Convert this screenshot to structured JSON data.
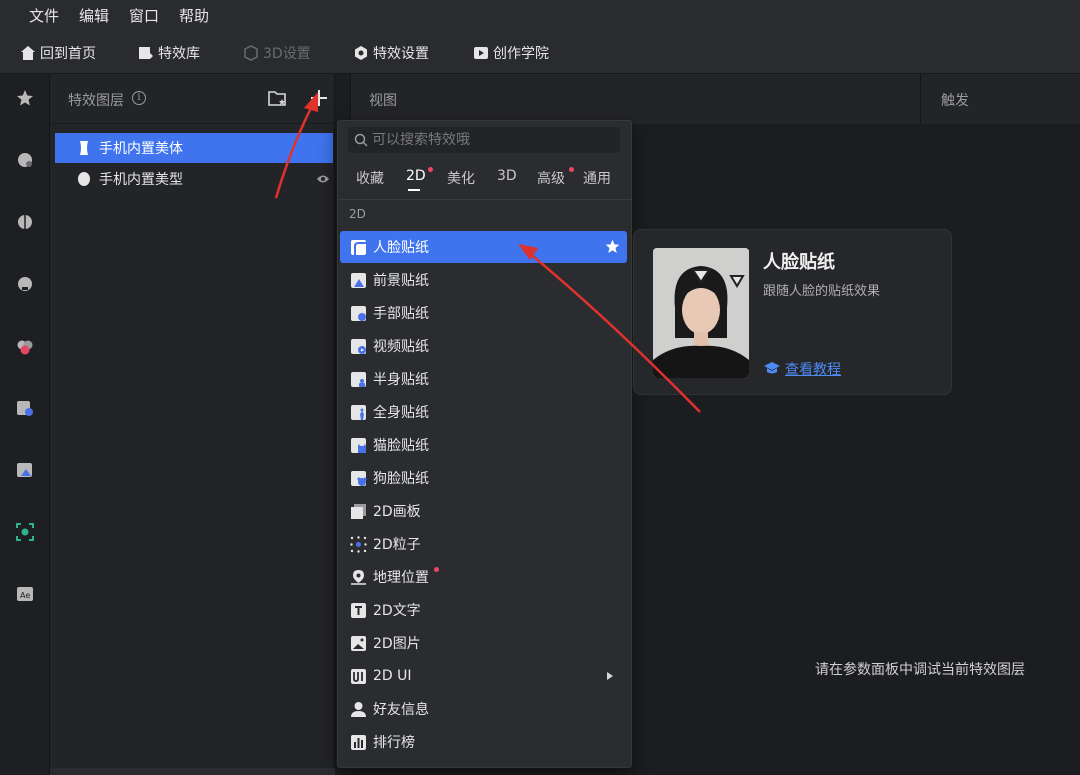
{
  "menubar": {
    "items": [
      "文件",
      "编辑",
      "窗口",
      "帮助"
    ]
  },
  "toolbar": {
    "home": "回到首页",
    "library": "特效库",
    "settings3d": "3D设置",
    "effect_settings": "特效设置",
    "academy": "创作学院"
  },
  "layers_panel": {
    "title": "特效图层",
    "layers": [
      {
        "label": "手机内置美体",
        "selected": true
      },
      {
        "label": "手机内置美型",
        "selected": false
      }
    ]
  },
  "view_panel": {
    "title": "视图"
  },
  "trigger_panel": {
    "title": "触发"
  },
  "dropdown": {
    "search_placeholder": "可以搜索特效哦",
    "tabs": [
      "收藏",
      "2D",
      "美化",
      "3D",
      "高级",
      "通用"
    ],
    "active_tab": "2D",
    "section_label": "2D",
    "items": [
      {
        "label": "人脸贴纸",
        "icon": "face-sticker-icon",
        "selected": true
      },
      {
        "label": "前景贴纸",
        "icon": "foreground-sticker-icon"
      },
      {
        "label": "手部贴纸",
        "icon": "hand-sticker-icon"
      },
      {
        "label": "视频贴纸",
        "icon": "video-sticker-icon"
      },
      {
        "label": "半身贴纸",
        "icon": "halfbody-sticker-icon"
      },
      {
        "label": "全身贴纸",
        "icon": "fullbody-sticker-icon"
      },
      {
        "label": "猫脸贴纸",
        "icon": "catface-sticker-icon"
      },
      {
        "label": "狗脸贴纸",
        "icon": "dogface-sticker-icon"
      },
      {
        "label": "2D画板",
        "icon": "canvas-icon"
      },
      {
        "label": "2D粒子",
        "icon": "particle-icon"
      },
      {
        "label": "地理位置",
        "icon": "location-icon"
      },
      {
        "label": "2D文字",
        "icon": "text-icon"
      },
      {
        "label": "2D图片",
        "icon": "image-icon"
      },
      {
        "label": "2D UI",
        "icon": "ui-icon"
      },
      {
        "label": "好友信息",
        "icon": "friend-icon"
      },
      {
        "label": "排行榜",
        "icon": "ranking-icon"
      }
    ]
  },
  "preview": {
    "title": "人脸贴纸",
    "description": "跟随人脸的贴纸效果",
    "link": "查看教程"
  },
  "hint": "请在参数面板中调试当前特效图层",
  "colors": {
    "accent": "#3f74ee",
    "background": "#1c1d20",
    "panel": "#232427",
    "badge": "#f0455a",
    "annotation_arrow": "#e0322c",
    "link": "#4d8bf5"
  }
}
